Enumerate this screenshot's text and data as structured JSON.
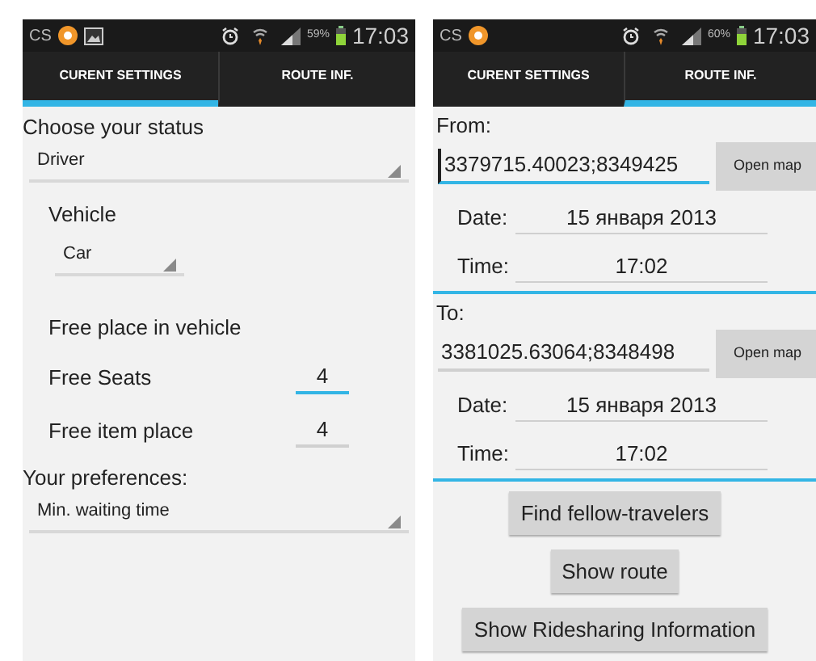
{
  "phones": [
    {
      "status_bar": {
        "app_label": "CS",
        "notifications": [
          {
            "kind": "app"
          },
          {
            "kind": "gallery"
          }
        ],
        "battery": "59%",
        "time": "17:03"
      },
      "tabs": [
        {
          "label": "CURENT SETTINGS",
          "selected": true
        },
        {
          "label": "ROUTE INF.",
          "selected": false
        }
      ],
      "settings": [
        {
          "kind": "heading",
          "text": "Choose your status"
        },
        {
          "kind": "spinner",
          "value": "Driver"
        },
        {
          "kind": "subheading",
          "text": "Vehicle"
        },
        {
          "kind": "subspinner",
          "value": "Car"
        },
        {
          "kind": "subheading",
          "text": "Free place in vehicle"
        },
        {
          "kind": "number",
          "label": "Free Seats",
          "value": "4",
          "focused": true
        },
        {
          "kind": "number",
          "label": "Free item place",
          "value": "4",
          "focused": false
        },
        {
          "kind": "heading",
          "text": "Your preferences:"
        },
        {
          "kind": "spinner",
          "value": "Min. waiting time"
        }
      ]
    },
    {
      "status_bar": {
        "app_label": "CS",
        "notifications": [
          {
            "kind": "app"
          }
        ],
        "battery": "60%",
        "time": "17:03"
      },
      "tabs": [
        {
          "label": "CURENT SETTINGS",
          "selected": false
        },
        {
          "label": "ROUTE INF.",
          "selected": true
        }
      ],
      "route": [
        {
          "label": "From:",
          "location": "3379715.40023;8349425",
          "focused": true,
          "map_button": "Open map",
          "date_label": "Date:",
          "date": "15 января 2013",
          "time_label": "Time:",
          "time": "17:02"
        },
        {
          "label": "To:",
          "location": "3381025.63064;8348498",
          "focused": false,
          "map_button": "Open map",
          "date_label": "Date:",
          "date": "15 января 2013",
          "time_label": "Time:",
          "time": "17:02"
        }
      ],
      "actions": [
        "Find fellow-travelers",
        "Show route",
        "Show Ridesharing Information"
      ]
    }
  ]
}
